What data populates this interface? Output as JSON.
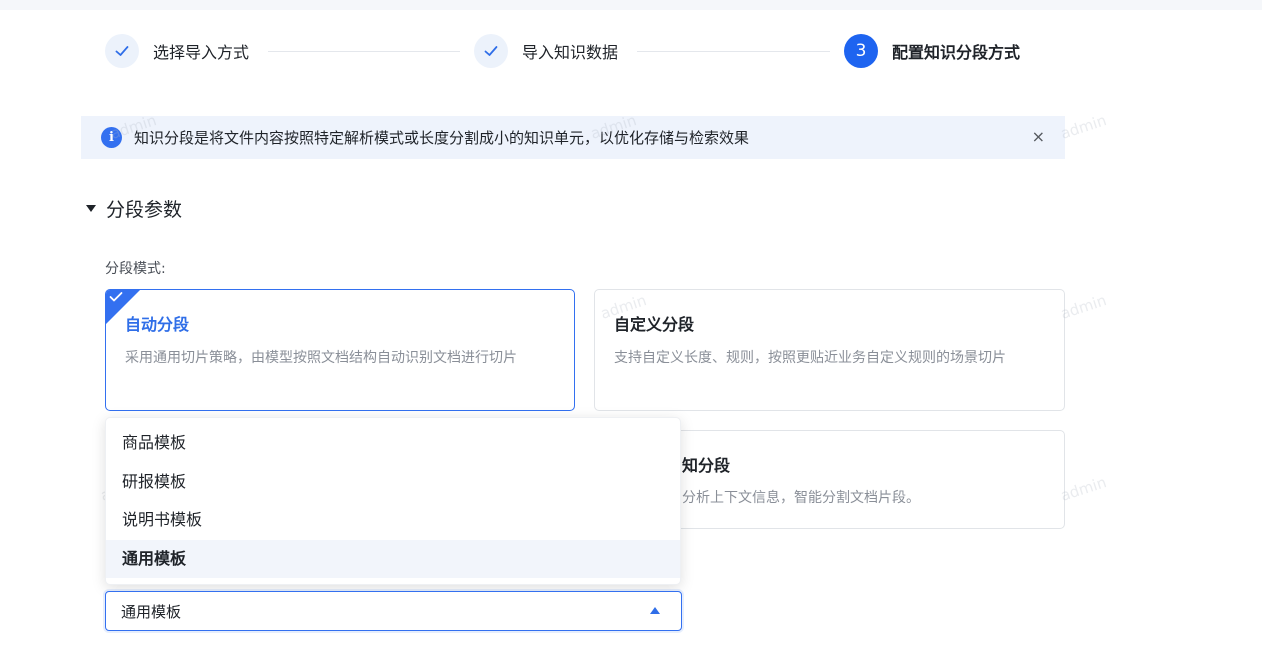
{
  "steps": [
    {
      "label": "选择导入方式",
      "state": "done",
      "icon": "check-icon"
    },
    {
      "label": "导入知识数据",
      "state": "done",
      "icon": "check-icon"
    },
    {
      "label": "配置知识分段方式",
      "state": "active",
      "number": "3"
    }
  ],
  "alert": {
    "icon": "info-icon",
    "icon_glyph": "i",
    "text": "知识分段是将文件内容按照特定解析模式或长度分割成小的知识单元，以优化存储与检索效果",
    "close_glyph": "×"
  },
  "section": {
    "title": "分段参数"
  },
  "mode": {
    "label": "分段模式:",
    "cards": [
      {
        "title": "自动分段",
        "desc": "采用通用切片策略，由模型按照文档结构自动识别文档进行切片",
        "selected": true
      },
      {
        "title": "自定义分段",
        "desc": "支持自定义长度、规则，按照更贴近业务自定义规则的场景切片",
        "selected": false
      },
      {
        "title": "知分段",
        "desc": "分析上下文信息，智能分割文档片段。",
        "selected": false
      }
    ]
  },
  "template_select": {
    "value": "通用模板",
    "options": [
      "商品模板",
      "研报模板",
      "说明书模板",
      "通用模板"
    ],
    "selected_index": 3
  },
  "watermark": "admin",
  "colors": {
    "accent": "#3370f0",
    "alert_bg": "#eef3fc",
    "selected_row": "#f2f5fb"
  }
}
